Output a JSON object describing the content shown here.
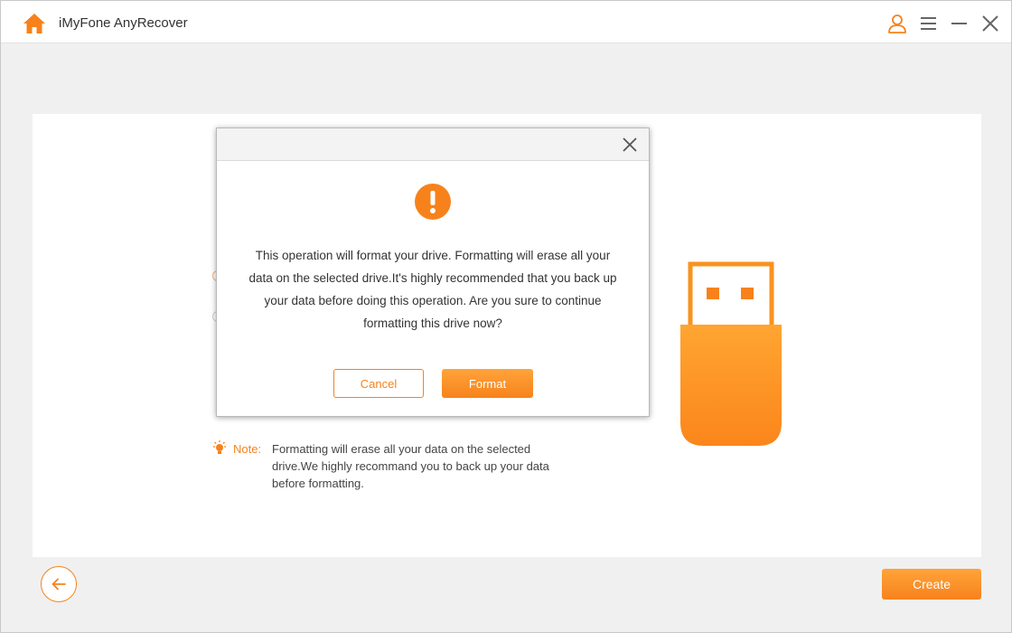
{
  "app": {
    "title": "iMyFone AnyRecover"
  },
  "titlebar": {
    "icons": [
      "home-icon",
      "account-icon",
      "menu-icon",
      "minimize-icon",
      "close-icon"
    ]
  },
  "background_content": {
    "note_label": "Note:",
    "note_text": "Formatting will erase all your data on the selected drive.We highly recommand you to back up your data before formatting.",
    "usb_icon": "usb-drive-icon"
  },
  "footer": {
    "back_icon": "arrow-left-icon",
    "create_label": "Create"
  },
  "dialog": {
    "icon": "warning-icon",
    "message": "This operation will format your drive. Formatting will erase all your data on the selected drive.It's highly recommended that you back up your data before doing this operation. Are you sure to continue formatting this drive now?",
    "cancel_label": "Cancel",
    "format_label": "Format"
  },
  "colors": {
    "accent": "#f7821c",
    "accent_light": "#ffa43a",
    "background": "#f0f0f0",
    "panel": "#ffffff"
  }
}
